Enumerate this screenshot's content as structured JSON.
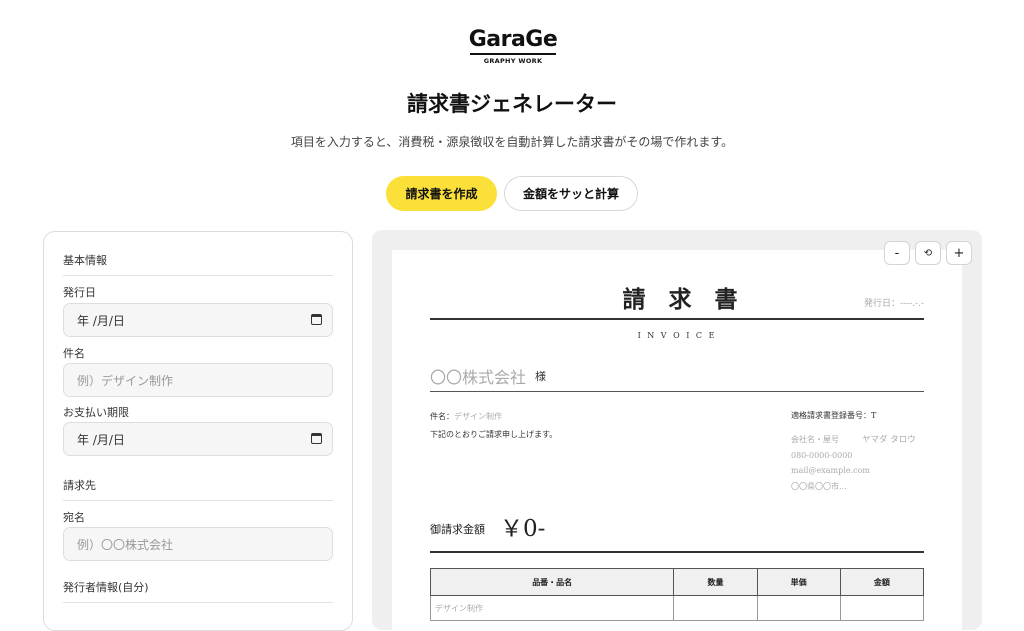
{
  "brand": {
    "logo_text": "GaraGe",
    "logo_sub": "GRAPHY WORK"
  },
  "page": {
    "title": "請求書ジェネレーター",
    "description": "項目を入力すると、消費税・源泉徴収を自動計算した請求書がその場で作れます。"
  },
  "actions": {
    "create_label": "請求書を作成",
    "calc_label": "金額をサッと計算"
  },
  "form": {
    "basic_header": "基本情報",
    "issue_date_label": "発行日",
    "issue_date_value": "年 /月/日",
    "subject_label": "件名",
    "subject_placeholder": "例）デザイン制作",
    "due_label": "お支払い期限",
    "due_value": "年 /月/日",
    "billto_header": "請求先",
    "recipient_label": "宛名",
    "recipient_placeholder": "例）〇〇株式会社",
    "issuer_header": "発行者情報(自分)"
  },
  "zoom": {
    "minus": "-",
    "reset": "⟲",
    "plus": "+"
  },
  "invoice": {
    "title": "請　求　書",
    "issue_date": "発行日：----.-.-",
    "subtitle": "I N V O I C E",
    "client": "〇〇株式会社",
    "honorific": "様",
    "subject_label": "件名：",
    "subject_value": "デザイン制作",
    "intro": "下記のとおりご請求申し上げます。",
    "reg_no": "適格請求書登録番号：T",
    "company_title": "会社名・屋号",
    "issuer_name": "ヤマダ タロウ",
    "phone": "080-0000-0000",
    "email": "mail@example.com",
    "address": "〇〇県〇〇市...",
    "amount_label": "御請求金額",
    "amount_value": "￥0-",
    "table_headers": [
      "品番・品名",
      "数量",
      "単価",
      "金額"
    ],
    "first_row_item": "デザイン制作"
  }
}
